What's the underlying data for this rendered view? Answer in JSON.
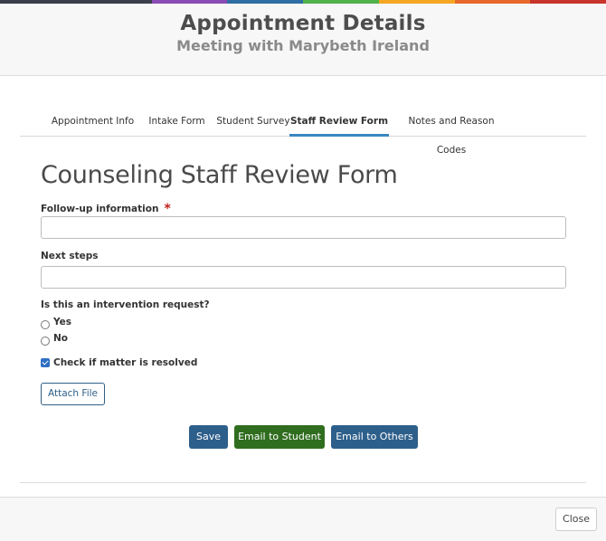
{
  "colors": {
    "top_bar": [
      "#3a3f4b",
      "#3a3f4b",
      "#8a4bb5",
      "#2e6ea3",
      "#4fb24a",
      "#f5a623",
      "#e8692c",
      "#c7342b"
    ],
    "primary_button": "#2d5f8b",
    "success_button": "#2f6d1f",
    "active_tab_underline": "#3a87c0",
    "required": "#c0201a"
  },
  "header": {
    "title": "Appointment Details",
    "subtitle": "Meeting with Marybeth Ireland"
  },
  "tabs": [
    {
      "label": "Appointment Info",
      "active": false
    },
    {
      "label": "Intake Form",
      "active": false
    },
    {
      "label": "Student Survey",
      "active": false
    },
    {
      "label": "Staff Review Form",
      "active": true
    },
    {
      "label": "Notes and Reason Codes",
      "active": false
    }
  ],
  "form": {
    "title": "Counseling Staff Review Form",
    "followup_label": "Follow-up information",
    "required_mark": "*",
    "followup_value": "",
    "next_steps_label": "Next steps",
    "next_steps_value": "",
    "intervention_question": "Is this an intervention request?",
    "option_yes": "Yes",
    "option_no": "No",
    "intervention_selected": null,
    "resolved_label": "Check if matter is resolved",
    "resolved_checked": true,
    "attach_label": "Attach File"
  },
  "actions": {
    "save": "Save",
    "email_student": "Email to Student",
    "email_others": "Email to Others"
  },
  "footer": {
    "close": "Close"
  }
}
